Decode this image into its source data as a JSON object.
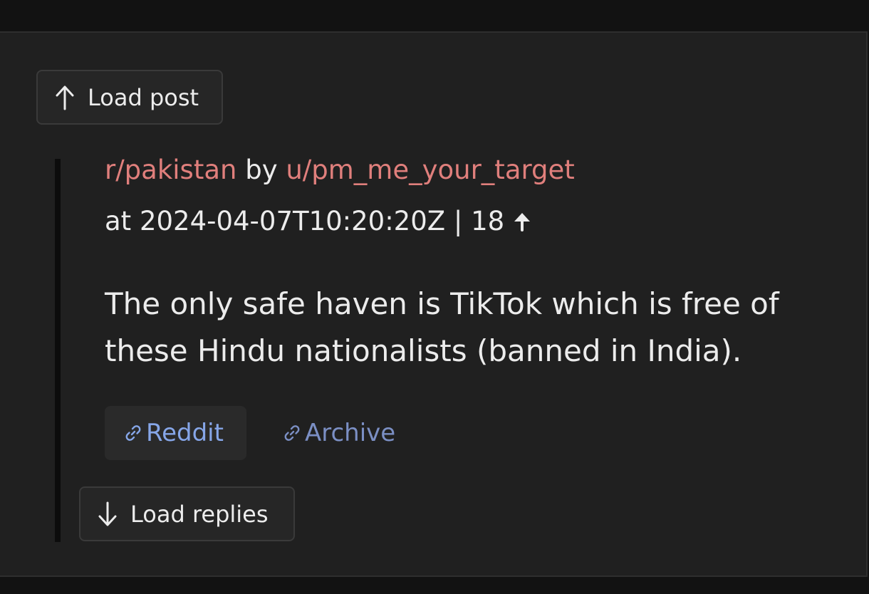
{
  "buttons": {
    "load_post": "Load post",
    "load_replies": "Load replies"
  },
  "post": {
    "subreddit": "r/pakistan",
    "by": " by ",
    "author": "u/pm_me_your_target",
    "at_prefix": "at ",
    "timestamp": "2024-04-07T10:20:20Z",
    "separator": " | ",
    "score": "18",
    "body": "The only safe haven is TikTok which is free of these Hindu nationalists (banned in India)."
  },
  "links": {
    "reddit": "Reddit",
    "archive": "Archive"
  },
  "icons": {
    "load_post": "arrow-up-icon",
    "load_replies": "arrow-down-icon",
    "score": "upvote-arrow-icon",
    "link": "chain-link-icon"
  },
  "colors": {
    "background": "#121212",
    "card": "#202020",
    "accent_red": "#e07f7c",
    "link_blue": "#86a6e8",
    "link_blue_muted": "#7b8fc4"
  }
}
